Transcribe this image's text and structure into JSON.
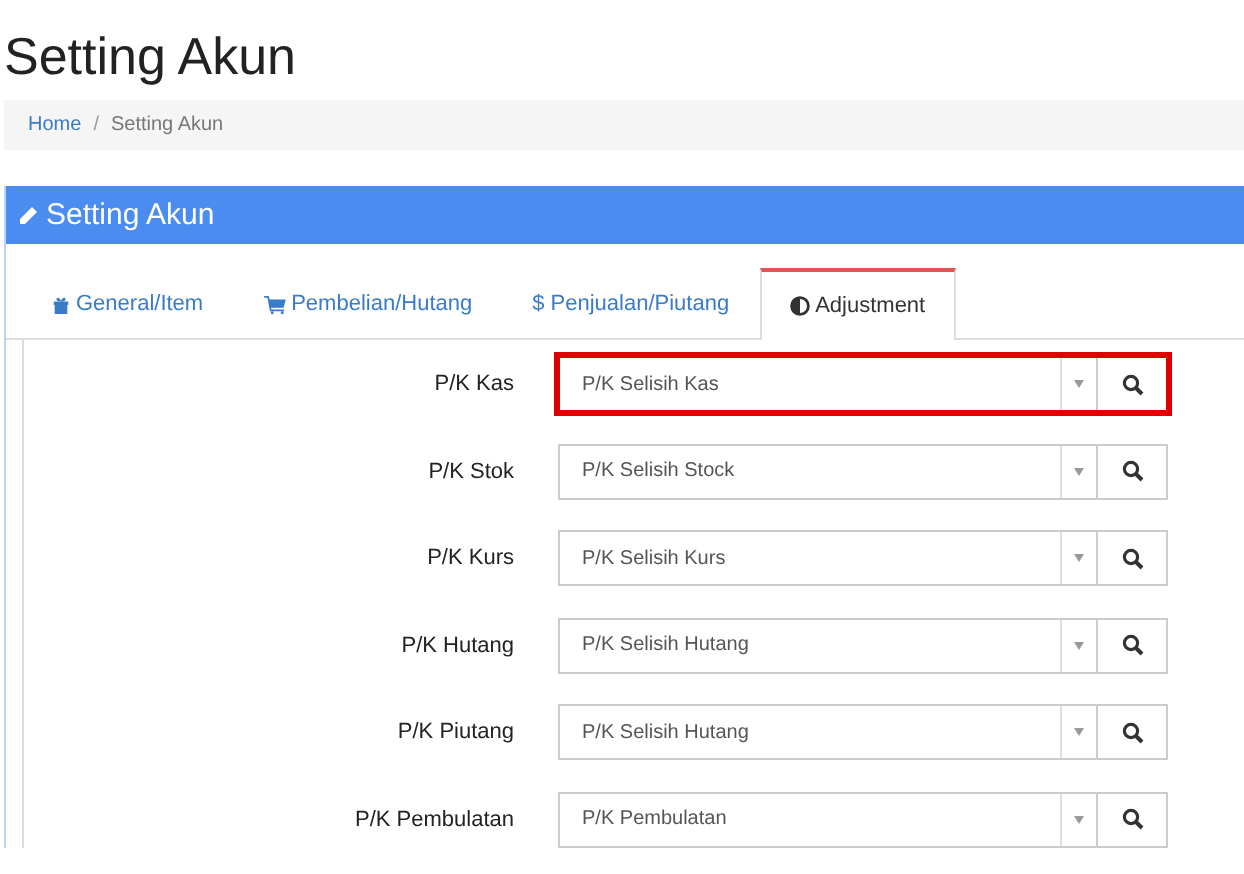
{
  "page_title": "Setting Akun",
  "breadcrumb_separator": "/",
  "breadcrumb": [
    {
      "label": "Home",
      "link": true
    },
    {
      "label": "Setting Akun",
      "link": false
    }
  ],
  "panel": {
    "title": "Setting Akun"
  },
  "tabs": [
    {
      "label": "General/Item",
      "selected": false
    },
    {
      "label": "Pembelian/Hutang",
      "selected": false
    },
    {
      "label": "$ Penjualan/Piutang",
      "selected": false
    },
    {
      "label": "Adjustment",
      "selected": true
    }
  ],
  "fields": [
    {
      "label": "P/K Kas",
      "value": "P/K Selisih Kas",
      "highlighted": true
    },
    {
      "label": "P/K Stok",
      "value": "P/K Selisih Stock",
      "highlighted": false
    },
    {
      "label": "P/K Kurs",
      "value": "P/K Selisih Kurs",
      "highlighted": false
    },
    {
      "label": "P/K Hutang",
      "value": "P/K Selisih Hutang",
      "highlighted": false
    },
    {
      "label": "P/K Piutang",
      "value": "P/K Selisih Hutang",
      "highlighted": false
    },
    {
      "label": "P/K Pembulatan",
      "value": "P/K Pembulatan",
      "highlighted": false
    }
  ]
}
